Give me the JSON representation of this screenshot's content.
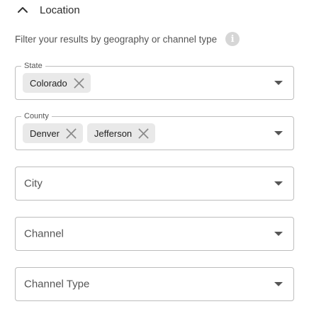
{
  "section": {
    "title": "Location",
    "description": "Filter your results by geography or channel type",
    "info_icon": "info-icon",
    "info_glyph": "i"
  },
  "fields": {
    "state": {
      "label": "State",
      "chips": [
        "Colorado"
      ]
    },
    "county": {
      "label": "County",
      "chips": [
        "Denver",
        "Jefferson"
      ]
    },
    "city": {
      "placeholder": "City"
    },
    "channel": {
      "placeholder": "Channel"
    },
    "channel_type": {
      "placeholder": "Channel Type"
    }
  },
  "colors": {
    "border": "#bdbdbd",
    "chip_bg": "#e9e9e9",
    "info_bg": "#d6d6d6"
  }
}
